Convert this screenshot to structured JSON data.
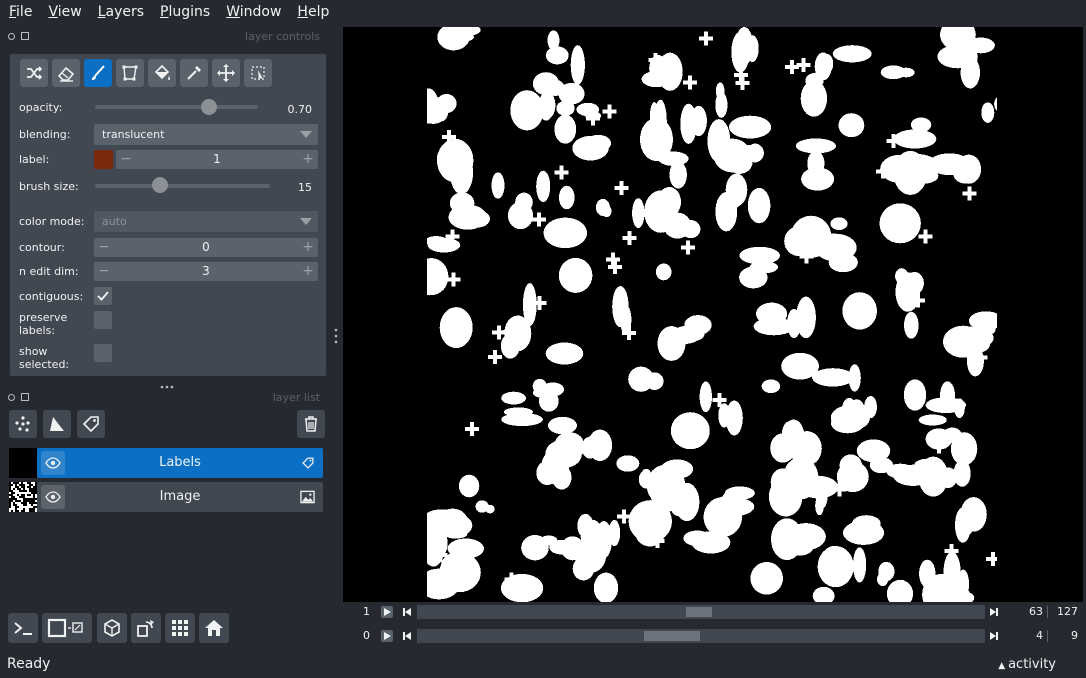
{
  "menu": [
    {
      "key": "F",
      "rest": "ile"
    },
    {
      "key": "V",
      "rest": "iew"
    },
    {
      "key": "L",
      "rest": "ayers"
    },
    {
      "key": "P",
      "rest": "lugins"
    },
    {
      "key": "W",
      "rest": "indow"
    },
    {
      "key": "H",
      "rest": "elp"
    }
  ],
  "layer_controls": {
    "header": "layer controls",
    "tools": [
      "shuffle-icon",
      "eraser-icon",
      "paint-brush-icon",
      "polygon-icon",
      "fill-bucket-icon",
      "picker-icon",
      "pan-zoom-icon",
      "transform-icon"
    ],
    "active_tool": "paint-brush-icon",
    "opacity": {
      "label": "opacity:",
      "value": "0.70",
      "fraction": 0.7
    },
    "blending": {
      "label": "blending:",
      "value": "translucent"
    },
    "label": {
      "label": "label:",
      "value": "1",
      "color": "#7a2a0e"
    },
    "brush_size": {
      "label": "brush size:",
      "value": "15",
      "fraction": 0.37
    },
    "color_mode": {
      "label": "color mode:",
      "value": "auto"
    },
    "contour": {
      "label": "contour:",
      "value": "0"
    },
    "n_edit_dim": {
      "label": "n edit dim:",
      "value": "3"
    },
    "contiguous": {
      "label": "contiguous:",
      "checked": true
    },
    "preserve_labels": {
      "label_line1": "preserve",
      "label_line2": "labels:",
      "checked": false
    },
    "show_selected": {
      "label_line1": "show",
      "label_line2": "selected:",
      "checked": false
    }
  },
  "layer_list": {
    "header": "layer list",
    "layers": [
      {
        "name": "Labels",
        "selected": true,
        "type_icon": "label-tag-icon"
      },
      {
        "name": "Image",
        "selected": false,
        "type_icon": "image-icon"
      }
    ]
  },
  "dims": [
    {
      "index": "1",
      "current": "63",
      "total": "127",
      "fraction": 0.496
    },
    {
      "index": "0",
      "current": "4",
      "total": "9",
      "fraction": 0.444
    }
  ],
  "status": {
    "text": "Ready",
    "activity": "activity"
  },
  "colors": {
    "accent": "#0b6fc4",
    "panel": "#414851",
    "background": "#262930"
  }
}
